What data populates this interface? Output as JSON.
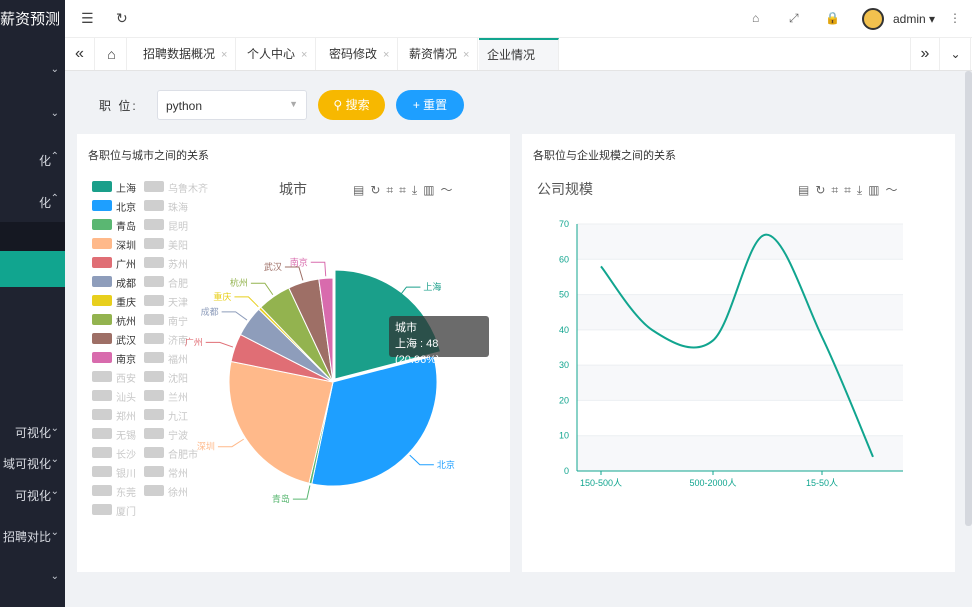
{
  "sidebar": {
    "brand": "薪资预测",
    "items": [
      {
        "label": "",
        "top": 54,
        "chev": "⌄"
      },
      {
        "label": "",
        "top": 98,
        "chev": "⌄"
      },
      {
        "label": "化",
        "top": 141,
        "chev": "⌃"
      },
      {
        "label": "化",
        "top": 183,
        "chev": "⌃"
      },
      {
        "label": "",
        "top": 222,
        "chev": ""
      },
      {
        "label": "",
        "top": 251,
        "chev": ""
      },
      {
        "label": "可视化",
        "top": 413,
        "chev": "⌄"
      },
      {
        "label": "域可视化",
        "top": 444,
        "chev": "⌄"
      },
      {
        "label": "可视化",
        "top": 476,
        "chev": "⌄"
      },
      {
        "label": "招聘对比",
        "top": 517,
        "chev": "⌄"
      },
      {
        "label": "",
        "top": 561,
        "chev": "⌄"
      }
    ]
  },
  "topbar": {
    "user": "admin",
    "icons": [
      "menu-fold-icon",
      "refresh-icon",
      "tag-icon",
      "fullscreen-icon",
      "lock-icon",
      "more-icon"
    ]
  },
  "tabs": [
    {
      "label": "招聘数据概况",
      "active": false
    },
    {
      "label": "个人中心",
      "active": false
    },
    {
      "label": "密码修改",
      "active": false
    },
    {
      "label": "薪资情况",
      "active": false
    },
    {
      "label": "企业情况",
      "active": true
    }
  ],
  "filter": {
    "label": "职 位:",
    "position_value": "python",
    "search_label": "搜索",
    "reset_label": "重置"
  },
  "left_panel": {
    "title": "各职位与城市之间的关系",
    "chart_title": "城市",
    "tooltip": {
      "title": "城市",
      "text": "上海 : 48 (20.96%)"
    }
  },
  "right_panel": {
    "title": "各职位与企业规模之间的关系",
    "chart_title": "公司规模"
  },
  "colors": {
    "accent": "#11a58f",
    "search": "#f7b800",
    "reset": "#1e9fff"
  },
  "chart_data": [
    {
      "type": "pie",
      "title": "城市",
      "legend_active": [
        {
          "name": "上海",
          "color": "#1a9f8a"
        },
        {
          "name": "北京",
          "color": "#1e9fff"
        },
        {
          "name": "青岛",
          "color": "#5ab772"
        },
        {
          "name": "深圳",
          "color": "#ffb98a"
        },
        {
          "name": "广州",
          "color": "#e06e75"
        },
        {
          "name": "成都",
          "color": "#8e9dbb"
        },
        {
          "name": "重庆",
          "color": "#e8cf1d"
        },
        {
          "name": "杭州",
          "color": "#93b34f"
        },
        {
          "name": "武汉",
          "color": "#9e6f66"
        },
        {
          "name": "南京",
          "color": "#d86bad"
        }
      ],
      "legend_inactive": [
        "乌鲁木齐",
        "珠海",
        "昆明",
        "美阳",
        "苏州",
        "合肥",
        "天津",
        "南宁",
        "济南",
        "福州",
        "西安",
        "沈阳",
        "汕头",
        "兰州",
        "郑州",
        "九江",
        "无锡",
        "宁波",
        "长沙",
        "合肥市",
        "银川",
        "常州",
        "东莞",
        "徐州",
        "厦门"
      ],
      "slices": [
        {
          "name": "上海",
          "value": 48
        },
        {
          "name": "北京",
          "value": 74
        },
        {
          "name": "青岛",
          "value": 1
        },
        {
          "name": "深圳",
          "value": 56
        },
        {
          "name": "广州",
          "value": 10
        },
        {
          "name": "成都",
          "value": 11
        },
        {
          "name": "重庆",
          "value": 1
        },
        {
          "name": "杭州",
          "value": 12
        },
        {
          "name": "武汉",
          "value": 11
        },
        {
          "name": "南京",
          "value": 5
        }
      ],
      "total": 229
    },
    {
      "type": "line",
      "title": "公司规模",
      "categories": [
        "150-500人",
        "",
        "500-2000人",
        "",
        "15-50人",
        ""
      ],
      "x_labels": [
        "150-500人",
        "500-2000人",
        "15-50人"
      ],
      "values": [
        58,
        40,
        37,
        67,
        38,
        4
      ],
      "ylim": [
        0,
        70
      ],
      "yticks": [
        0,
        10,
        20,
        30,
        40,
        50,
        60,
        70
      ],
      "grid": true,
      "color": "#11a58f"
    }
  ]
}
